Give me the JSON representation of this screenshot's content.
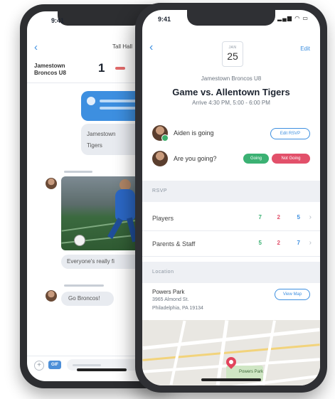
{
  "back_phone": {
    "status_time": "9:41",
    "nav_title": "Tall Hall",
    "score": {
      "team": "Jamestown Broncos U8",
      "value": "1"
    },
    "messages": [
      {
        "text_line1": "Jamestown",
        "text_line2": "Tigers"
      },
      {
        "text": "Everyone's really fi"
      },
      {
        "text": "Go Broncos!"
      }
    ],
    "compose": {
      "plus": "+",
      "gif": "GIF"
    }
  },
  "front_phone": {
    "status_time": "9:41",
    "status_icons": "▂▄▆ ◠ ▭",
    "nav": {
      "back": "‹",
      "edit": "Edit"
    },
    "date": {
      "month": "JAN",
      "day": "25"
    },
    "team": "Jamestown Broncos U8",
    "title": "Game vs. Allentown Tigers",
    "time": "Arrive 4:30 PM, 5:00 - 6:00 PM",
    "rsvp_rows": [
      {
        "text": "Aiden is going",
        "action": "Edit RSVP"
      },
      {
        "text": "Are you going?",
        "yes": "Going",
        "no": "Not Going"
      }
    ],
    "rsvp_section": "RSVP",
    "counts": [
      {
        "label": "Players",
        "going": "7",
        "not_going": "2",
        "unknown": "5"
      },
      {
        "label": "Parents & Staff",
        "going": "5",
        "not_going": "2",
        "unknown": "7"
      }
    ],
    "location_section": "Location",
    "location": {
      "name": "Powers Park",
      "address1": "3965 Almond St.",
      "address2": "Philadelphia, PA 19134",
      "action": "View Map",
      "map_label": "Powers Park"
    }
  },
  "colors": {
    "accent_blue": "#3d8fe0",
    "going_green": "#3bb173",
    "not_going_red": "#e2506a"
  }
}
